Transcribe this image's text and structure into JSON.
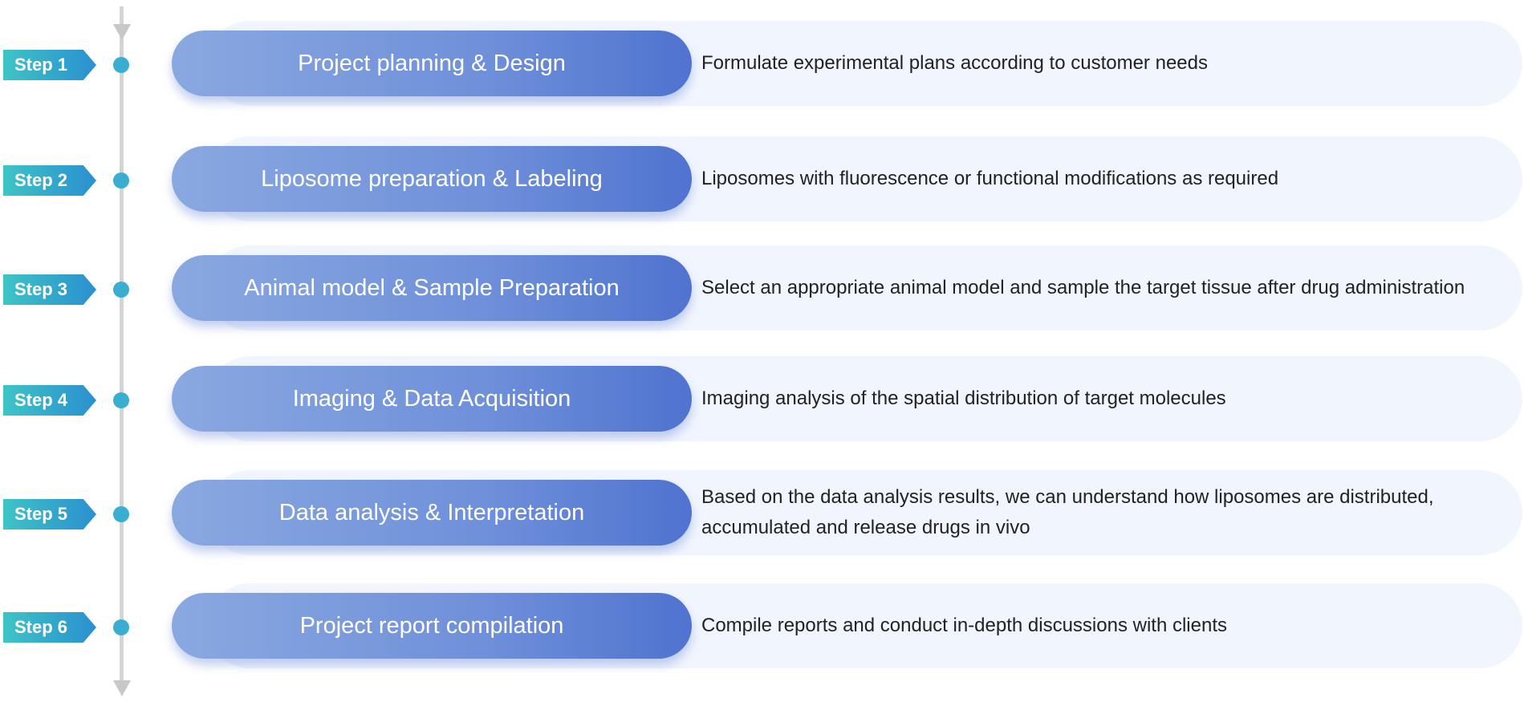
{
  "steps": [
    {
      "badge": "Step 1",
      "title": "Project planning & Design",
      "description": "Formulate experimental plans according to customer needs"
    },
    {
      "badge": "Step 2",
      "title": "Liposome preparation & Labeling",
      "description": "Liposomes with fluorescence or functional modifications as required"
    },
    {
      "badge": "Step 3",
      "title": "Animal model & Sample Preparation",
      "description": "Select an appropriate animal model and sample the target tissue after drug administration"
    },
    {
      "badge": "Step 4",
      "title": "Imaging & Data Acquisition",
      "description": "Imaging analysis of the spatial distribution of target molecules"
    },
    {
      "badge": "Step 5",
      "title": "Data analysis & Interpretation",
      "description": "Based on the data analysis results, we can understand how liposomes are distributed, accumulated and release drugs in vivo"
    },
    {
      "badge": "Step 6",
      "title": "Project report compilation",
      "description": "Compile reports and conduct in-depth discussions with clients"
    }
  ],
  "colors": {
    "badge": "#2fb0cc",
    "pill": "#6f90da",
    "bar": "#f1f5fe",
    "timeline": "#d4d4d4"
  }
}
